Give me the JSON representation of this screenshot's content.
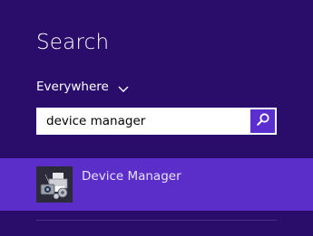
{
  "search_pane": {
    "title": "Search",
    "scope_label": "Everywhere",
    "query_value": "device manager",
    "search_button_icon": "magnifier-icon"
  },
  "results": [
    {
      "label": "Device Manager",
      "icon": "device-manager-icon"
    }
  ],
  "colors": {
    "background": "#2a0d6b",
    "accent": "#5b2ec9",
    "search_button": "#5b2fcf"
  }
}
